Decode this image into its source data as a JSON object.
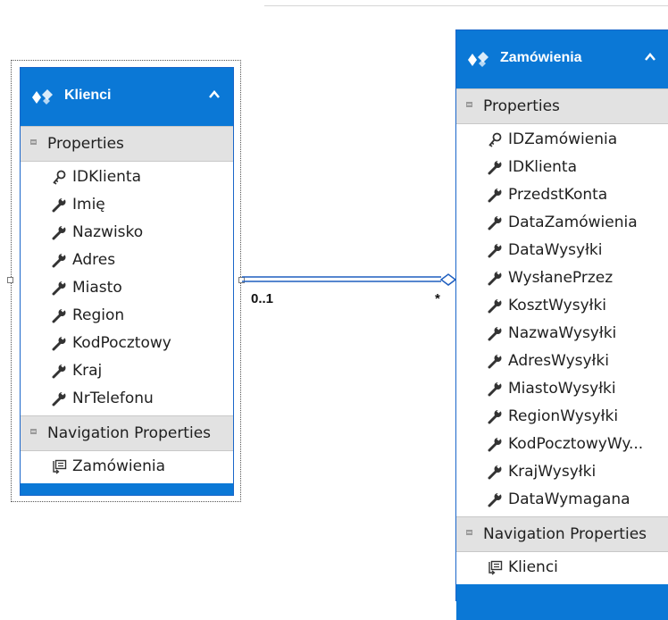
{
  "klienci": {
    "title": "Klienci",
    "properties_header": "Properties",
    "properties": [
      {
        "label": "IDKlienta",
        "key": true
      },
      {
        "label": "Imię",
        "key": false
      },
      {
        "label": "Nazwisko",
        "key": false
      },
      {
        "label": "Adres",
        "key": false
      },
      {
        "label": "Miasto",
        "key": false
      },
      {
        "label": "Region",
        "key": false
      },
      {
        "label": "KodPocztowy",
        "key": false
      },
      {
        "label": "Kraj",
        "key": false
      },
      {
        "label": "NrTelefonu",
        "key": false
      }
    ],
    "navigation_header": "Navigation Properties",
    "navigation": [
      {
        "label": "Zamówienia"
      }
    ]
  },
  "zamowienia": {
    "title": "Zamówienia",
    "properties_header": "Properties",
    "properties": [
      {
        "label": "IDZamówienia",
        "key": true
      },
      {
        "label": "IDKlienta",
        "key": false
      },
      {
        "label": "PrzedstKonta",
        "key": false
      },
      {
        "label": "DataZamówienia",
        "key": false
      },
      {
        "label": "DataWysyłki",
        "key": false
      },
      {
        "label": "WysłanePrzez",
        "key": false
      },
      {
        "label": "KosztWysyłki",
        "key": false
      },
      {
        "label": "NazwaWysyłki",
        "key": false
      },
      {
        "label": "AdresWysyłki",
        "key": false
      },
      {
        "label": "MiastoWysyłki",
        "key": false
      },
      {
        "label": "RegionWysyłki",
        "key": false
      },
      {
        "label": "KodPocztowyWy...",
        "key": false
      },
      {
        "label": "KrajWysyłki",
        "key": false
      },
      {
        "label": "DataWymagana",
        "key": false
      }
    ],
    "navigation_header": "Navigation Properties",
    "navigation": [
      {
        "label": "Klienci"
      }
    ]
  },
  "association": {
    "left_multiplicity": "0..1",
    "right_multiplicity": "*"
  },
  "colors": {
    "header_blue": "#0b78d6",
    "section_gray": "#e2e2e2",
    "connector_blue": "#1f5fbf"
  }
}
